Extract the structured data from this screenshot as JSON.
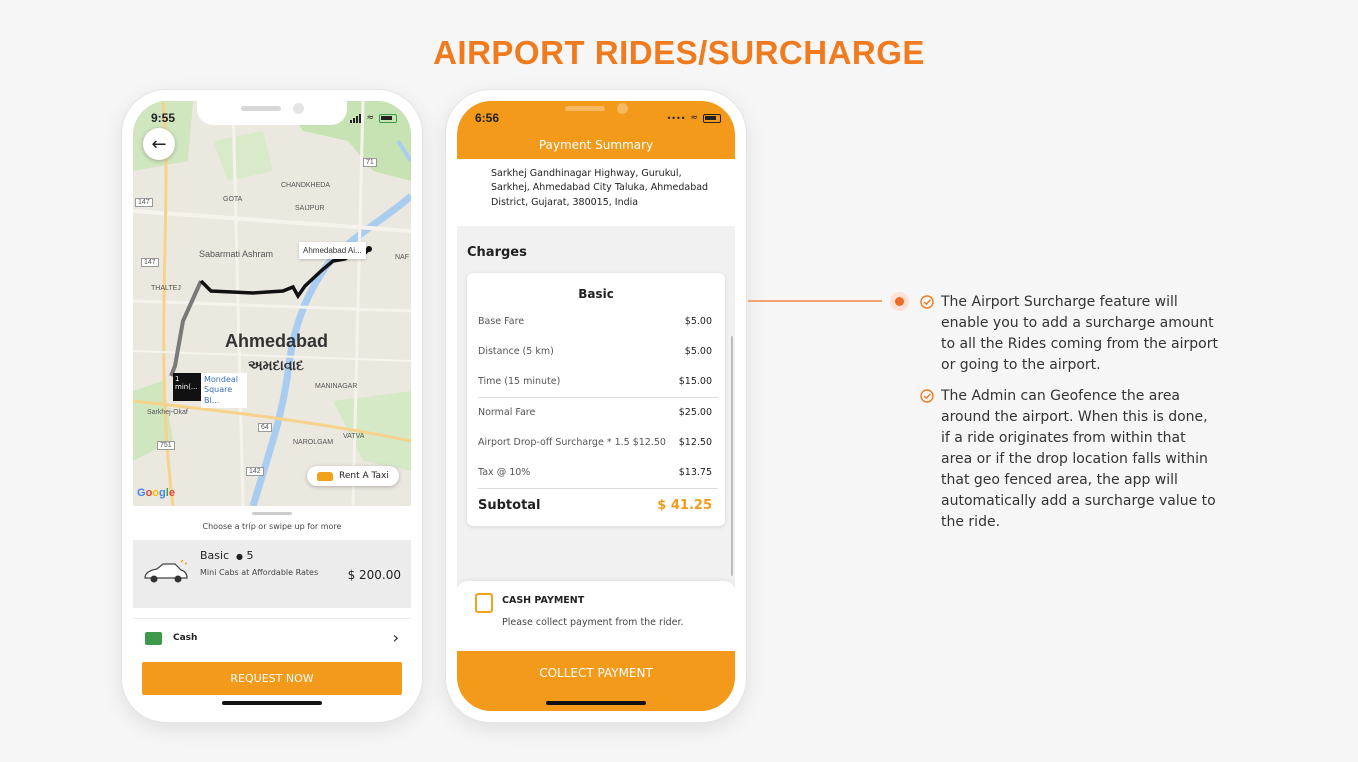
{
  "title": "AIRPORT RIDES/SURCHARGE",
  "left_phone": {
    "time": "9:55",
    "map": {
      "city_en": "Ahmedabad",
      "city_gu": "અમદાવાદ",
      "airport_label": "Ahmedabad Ai...",
      "eta_text": "1 min(...",
      "pickup_label": "Mondeal Square Bl...",
      "labels": [
        "GOTA",
        "CHANDKHEDA",
        "SAIJPUR",
        "Sabarmati Ashram",
        "THALTEJ",
        "MANINAGAR",
        "Sarkhej-Okaf",
        "VATVA",
        "NAROLGAM",
        "NAF"
      ],
      "road_numbers": [
        "147",
        "71",
        "147",
        "64",
        "751",
        "142"
      ],
      "google": "Google"
    },
    "rent_taxi": "Rent A Taxi",
    "sheet_hint": "Choose a trip or swipe up for more",
    "ride": {
      "name": "Basic",
      "seats": "5",
      "description": "Mini Cabs at Affordable Rates",
      "price": "$ 200.00"
    },
    "payment_method": "Cash",
    "request_button": "REQUEST NOW"
  },
  "right_phone": {
    "time": "6:56",
    "header_title": "Payment Summary",
    "address": "Sarkhej Gandhinagar Highway, Gurukul, Sarkhej, Ahmedabad City Taluka, Ahmedabad District, Gujarat, 380015, India",
    "charges_title": "Charges",
    "card_title": "Basic",
    "rows": [
      {
        "label": "Base Fare",
        "value": "$5.00"
      },
      {
        "label": "Distance (5 km)",
        "value": "$5.00"
      },
      {
        "label": "Time (15 minute)",
        "value": "$15.00"
      },
      {
        "label": "Normal Fare",
        "value": "$25.00"
      },
      {
        "label": "Airport Drop-off Surcharge * 1.5 $12.50",
        "value": "$12.50"
      },
      {
        "label": "Tax @ 10%",
        "value": "$13.75"
      }
    ],
    "subtotal_label": "Subtotal",
    "subtotal_value": "$ 41.25",
    "cash_payment_title": "CASH PAYMENT",
    "cash_payment_sub": "Please collect payment from the rider.",
    "collect_button": "COLLECT PAYMENT"
  },
  "features": [
    "The Airport Surcharge feature will enable you to add a surcharge amount to all the Rides coming from the airport or going to the airport.",
    "The Admin can Geofence the area around the airport. When this is done, if a ride originates from within that area or if the drop location falls within that geo fenced area, the app will automatically add a surcharge value to the ride."
  ],
  "colors": {
    "accent": "#f39a1b",
    "title": "#f07a1e",
    "connector": "#f4a172"
  },
  "icons": [
    "back-arrow-icon",
    "location-arrow-icon",
    "wifi-icon",
    "battery-icon",
    "signal-icon",
    "taxi-icon",
    "car-icon",
    "person-icon",
    "cash-icon",
    "chevron-right-icon",
    "cash-payment-icon",
    "check-circle-icon"
  ]
}
